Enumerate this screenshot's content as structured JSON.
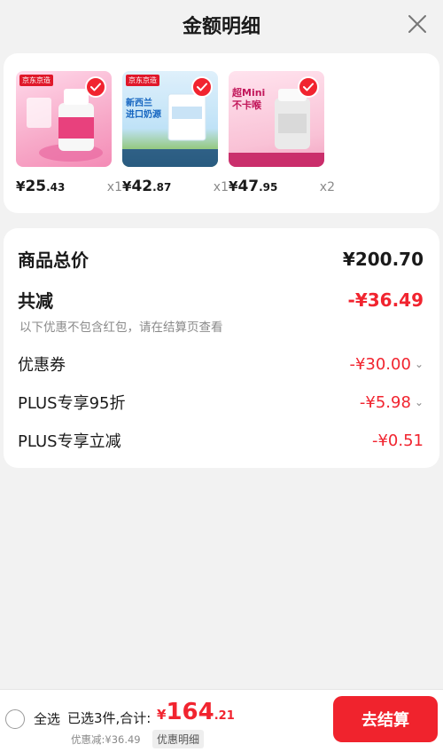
{
  "header": {
    "title": "金额明细"
  },
  "colors": {
    "accent": "#f1242f",
    "checkout": "#f0232d"
  },
  "products": [
    {
      "brand": "京东京造",
      "price_yen": "¥",
      "price_int": "25",
      "price_dec": ".43",
      "qty": "x1"
    },
    {
      "brand": "京东京造",
      "headline": "新西兰 进口奶源",
      "price_yen": "¥",
      "price_int": "42",
      "price_dec": ".87",
      "qty": "x1"
    },
    {
      "headline": "超Mini 不卡喉",
      "price_yen": "¥",
      "price_int": "47",
      "price_dec": ".95",
      "qty": "x2"
    }
  ],
  "summary": {
    "total_label": "商品总价",
    "total_value": "¥200.70",
    "reduce_label": "共减",
    "reduce_value": "-¥36.49",
    "note": "以下优惠不包含红包，请在结算页查看",
    "coupon_label": "优惠券",
    "coupon_value": "-¥30.00",
    "plus95_label": "PLUS专享95折",
    "plus95_value": "-¥5.98",
    "plusreduce_label": "PLUS专享立减",
    "plusreduce_value": "-¥0.51"
  },
  "bottom": {
    "select_all": "全选",
    "selected": "已选3件,合计:",
    "total_yen": "¥",
    "total_int": "164",
    "total_dec": ".21",
    "discount": "优惠减:¥36.49",
    "detail_link": "优惠明细",
    "checkout": "去结算"
  }
}
